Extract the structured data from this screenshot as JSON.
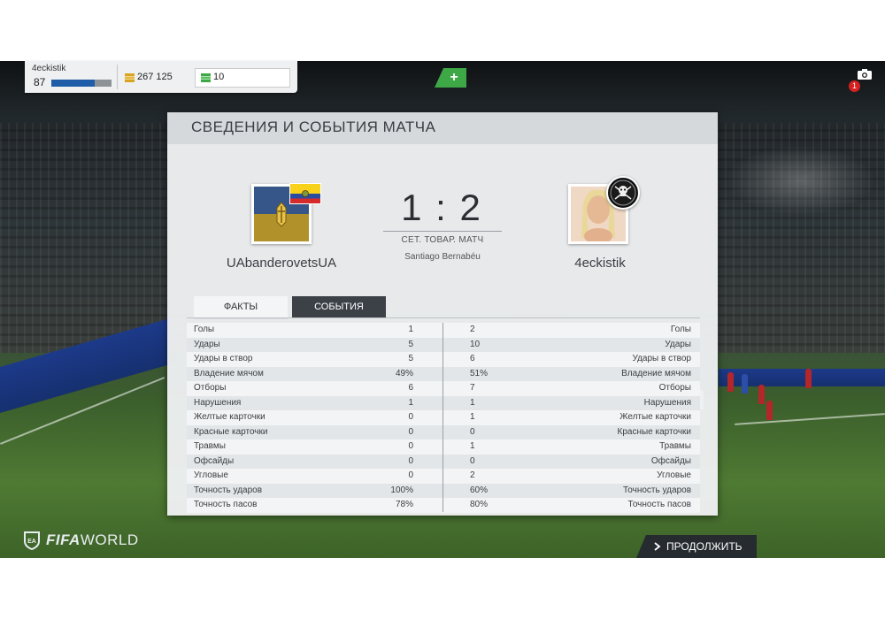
{
  "user": {
    "name": "4eckistik",
    "level": "87",
    "xp_progress": 0.72,
    "coins": "267 125",
    "points": "10",
    "add_points_label": "+"
  },
  "notifications": {
    "count": "1"
  },
  "panel": {
    "title": "СВЕДЕНИЯ И СОБЫТИЯ МАТЧА"
  },
  "match": {
    "home_team": "UAbanderovetsUA",
    "away_team": "4eckistik",
    "score": "1 : 2",
    "match_type": "СЕТ. ТОВАР. МАТЧ",
    "stadium": "Santiago Bernabéu"
  },
  "tabs": [
    {
      "label": "ФАКТЫ",
      "active": true
    },
    {
      "label": "СОБЫТИЯ",
      "active": false
    }
  ],
  "stats": [
    {
      "label": "Голы",
      "home": "1",
      "away": "2"
    },
    {
      "label": "Удары",
      "home": "5",
      "away": "10"
    },
    {
      "label": "Удары в створ",
      "home": "5",
      "away": "6"
    },
    {
      "label": "Владение мячом",
      "home": "49%",
      "away": "51%"
    },
    {
      "label": "Отборы",
      "home": "6",
      "away": "7"
    },
    {
      "label": "Нарушения",
      "home": "1",
      "away": "1"
    },
    {
      "label": "Желтые карточки",
      "home": "0",
      "away": "1"
    },
    {
      "label": "Красные карточки",
      "home": "0",
      "away": "0"
    },
    {
      "label": "Травмы",
      "home": "0",
      "away": "1"
    },
    {
      "label": "Офсайды",
      "home": "0",
      "away": "0"
    },
    {
      "label": "Угловые",
      "home": "0",
      "away": "2"
    },
    {
      "label": "Точность ударов",
      "home": "100%",
      "away": "60%"
    },
    {
      "label": "Точность пасов",
      "home": "78%",
      "away": "80%"
    }
  ],
  "footer": {
    "logo_bold": "FIFA",
    "logo_light": "WORLD",
    "continue_label": "ПРОДОЛЖИТЬ"
  },
  "icons": {
    "coin": "coin-icon",
    "points": "fifa-points-icon",
    "camera": "camera-icon",
    "continue": "chevron-right-icon"
  },
  "colors": {
    "accent_green": "#3fa846",
    "xp_bar": "#1f5da8",
    "notification_red": "#d62020"
  }
}
